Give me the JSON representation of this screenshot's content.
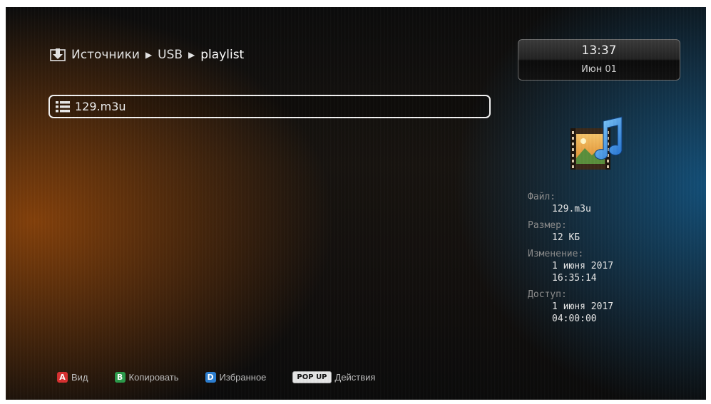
{
  "breadcrumb": {
    "icon": "download-box-icon",
    "items": [
      "Источники",
      "USB",
      "playlist"
    ],
    "separator_icon": "triangle-right-icon"
  },
  "list": {
    "items": [
      {
        "icon": "list-icon",
        "label": "129.m3u",
        "selected": true
      }
    ]
  },
  "clock": {
    "time": "13:37",
    "date": "Июн 01"
  },
  "preview": {
    "icon": "image-music-file-icon"
  },
  "info": {
    "file_label": "Файл:",
    "file_value": "129.m3u",
    "size_label": "Размер:",
    "size_value": "12 КБ",
    "modified_label": "Изменение:",
    "modified_date": "1 июня 2017",
    "modified_time": "16:35:14",
    "access_label": "Доступ:",
    "access_date": "1 июня 2017",
    "access_time": "04:00:00"
  },
  "footer": {
    "buttons": [
      {
        "key": "A",
        "label": "Вид",
        "color": "#d83030"
      },
      {
        "key": "B",
        "label": "Копировать",
        "color": "#2b9a4a"
      },
      {
        "key": "D",
        "label": "Избранное",
        "color": "#2c7fd2"
      },
      {
        "key": "POP UP",
        "label": "Действия",
        "color": "#e6e6e6"
      }
    ]
  }
}
